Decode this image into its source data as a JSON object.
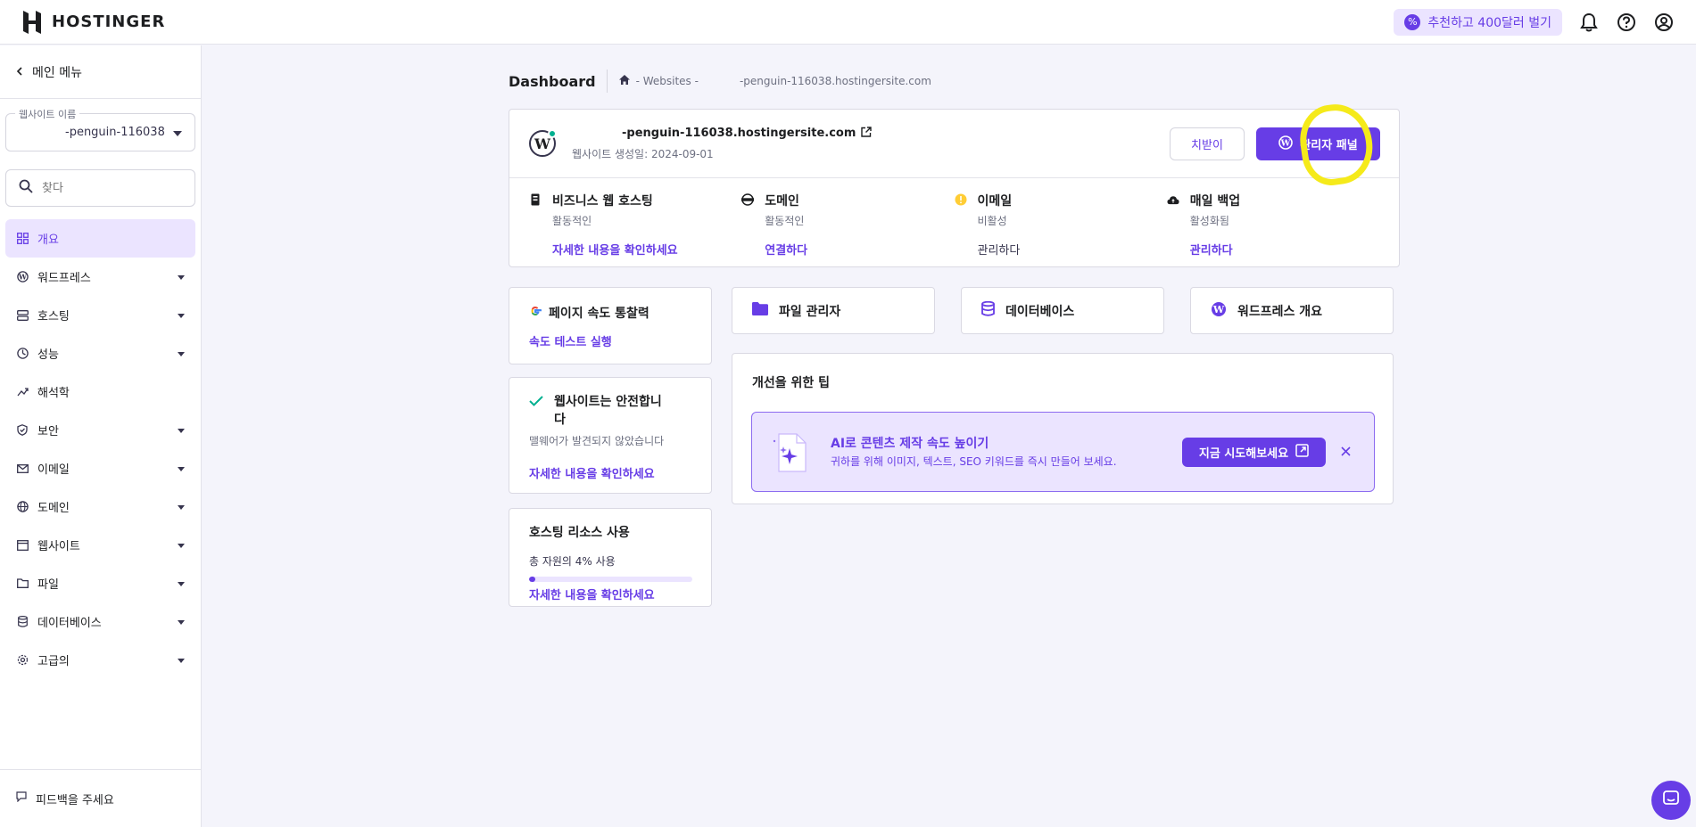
{
  "topbar": {
    "brand": "HOSTINGER",
    "referral_label": "추천하고 400달러 벌기",
    "icons": [
      "bell-icon",
      "help-icon",
      "account-icon"
    ]
  },
  "sidebar": {
    "back_label": "메인 메뉴",
    "site_select": {
      "label": "웹사이트 이름",
      "value": "-penguin-116038"
    },
    "search": {
      "placeholder": "찾다",
      "value": ""
    },
    "items": [
      {
        "label": "개요",
        "icon": "grid-icon",
        "active": true,
        "expandable": false
      },
      {
        "label": "워드프레스",
        "icon": "wordpress-icon",
        "active": false,
        "expandable": true
      },
      {
        "label": "호스팅",
        "icon": "server-icon",
        "active": false,
        "expandable": true
      },
      {
        "label": "성능",
        "icon": "gauge-icon",
        "active": false,
        "expandable": true
      },
      {
        "label": "해석학",
        "icon": "analytics-icon",
        "active": false,
        "expandable": false
      },
      {
        "label": "보안",
        "icon": "shield-icon",
        "active": false,
        "expandable": true
      },
      {
        "label": "이메일",
        "icon": "mail-icon",
        "active": false,
        "expandable": true
      },
      {
        "label": "도메인",
        "icon": "globe-icon",
        "active": false,
        "expandable": true
      },
      {
        "label": "웹사이트",
        "icon": "browser-icon",
        "active": false,
        "expandable": true
      },
      {
        "label": "파일",
        "icon": "folder-icon",
        "active": false,
        "expandable": true
      },
      {
        "label": "데이터베이스",
        "icon": "database-icon",
        "active": false,
        "expandable": true
      },
      {
        "label": "고급의",
        "icon": "gear-icon",
        "active": false,
        "expandable": true
      }
    ],
    "feedback_label": "피드백을 주세요"
  },
  "breadcrumb": {
    "title": "Dashboard",
    "path_prefix": "- Websites -",
    "path_domain": "-penguin-116038.hostingersite.com"
  },
  "site": {
    "domain": "-penguin-116038.hostingersite.com",
    "created": "웹사이트 생성일: 2024-09-01",
    "secondary_button": "치받이",
    "primary_button": "관리자 패널"
  },
  "services": [
    {
      "title": "비즈니스 웹 호스팅",
      "status": "활동적인",
      "link": "자세한 내용을 확인하세요",
      "icon": "hosting-icon",
      "link_style": "primary"
    },
    {
      "title": "도메인",
      "status": "활동적인",
      "link": "연결하다",
      "icon": "www-icon",
      "link_style": "primary"
    },
    {
      "title": "이메일",
      "status": "비활성",
      "link": "관리하다",
      "icon": "warning-icon",
      "link_style": "muted"
    },
    {
      "title": "매일 백업",
      "status": "활성화됨",
      "link": "관리하다",
      "icon": "cloud-upload-icon",
      "link_style": "primary"
    }
  ],
  "pagespeed": {
    "title": "페이지 속도 통찰력",
    "link": "속도 테스트 실행"
  },
  "security": {
    "title_line1": "웹사이트는 안전합니",
    "title_line2": "다",
    "text": "맬웨어가 발견되지 않았습니다",
    "link": "자세한 내용을 확인하세요"
  },
  "resources": {
    "title": "호스팅 리소스 사용",
    "text": "총 자원의 4% 사용",
    "usage_percent": 4,
    "link": "자세한 내용을 확인하세요"
  },
  "quick_links": [
    {
      "label": "파일 관리자",
      "icon": "folder-icon"
    },
    {
      "label": "데이터베이스",
      "icon": "database-icon"
    },
    {
      "label": "워드프레스 개요",
      "icon": "wordpress-icon"
    }
  ],
  "tips": {
    "title": "개선을 위한 팁",
    "heading": "AI로 콘텐츠 제작 속도 높이기",
    "text": "귀하를 위해 이미지, 텍스트, SEO 키워드를 즉시 만들어 보세요.",
    "button": "지금 시도해보세요"
  },
  "colors": {
    "accent": "#673de6",
    "accent_light": "#ebe4ff",
    "highlight": "#f5ea1a",
    "success": "#00b090",
    "warning": "#ffcd35"
  }
}
